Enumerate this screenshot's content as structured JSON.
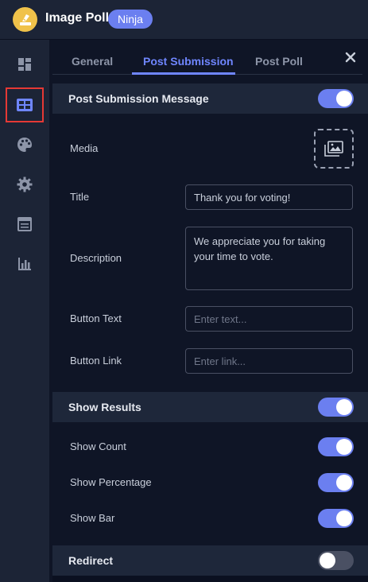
{
  "header": {
    "app_title": "Image Poll",
    "badge": "Ninja"
  },
  "sidebar": {
    "items": [
      {
        "icon": "dashboard-icon"
      },
      {
        "icon": "layout-icon",
        "active": true
      },
      {
        "icon": "palette-icon"
      },
      {
        "icon": "gear-icon"
      },
      {
        "icon": "form-icon"
      },
      {
        "icon": "bar-chart-icon"
      }
    ]
  },
  "tabs": [
    {
      "label": "General"
    },
    {
      "label": "Post Submission",
      "active": true
    },
    {
      "label": "Post Poll"
    }
  ],
  "post_submission": {
    "section_label": "Post Submission Message",
    "enabled": true,
    "media_label": "Media",
    "title_label": "Title",
    "title_value": "Thank you for voting!",
    "description_label": "Description",
    "description_value": "We appreciate you for taking your time to vote.",
    "button_text_label": "Button Text",
    "button_text_placeholder": "Enter text...",
    "button_link_label": "Button Link",
    "button_link_placeholder": "Enter link..."
  },
  "show_results": {
    "section_label": "Show Results",
    "enabled": true,
    "show_count_label": "Show Count",
    "show_count": true,
    "show_percentage_label": "Show Percentage",
    "show_percentage": true,
    "show_bar_label": "Show Bar",
    "show_bar": true
  },
  "redirect": {
    "section_label": "Redirect",
    "enabled": false
  },
  "colors": {
    "accent": "#6b7ff0",
    "active_tab": "#6f86ff",
    "sidebar_bg": "#1c2436",
    "panel_bg": "#0f1526",
    "active_outline": "#e53935"
  }
}
